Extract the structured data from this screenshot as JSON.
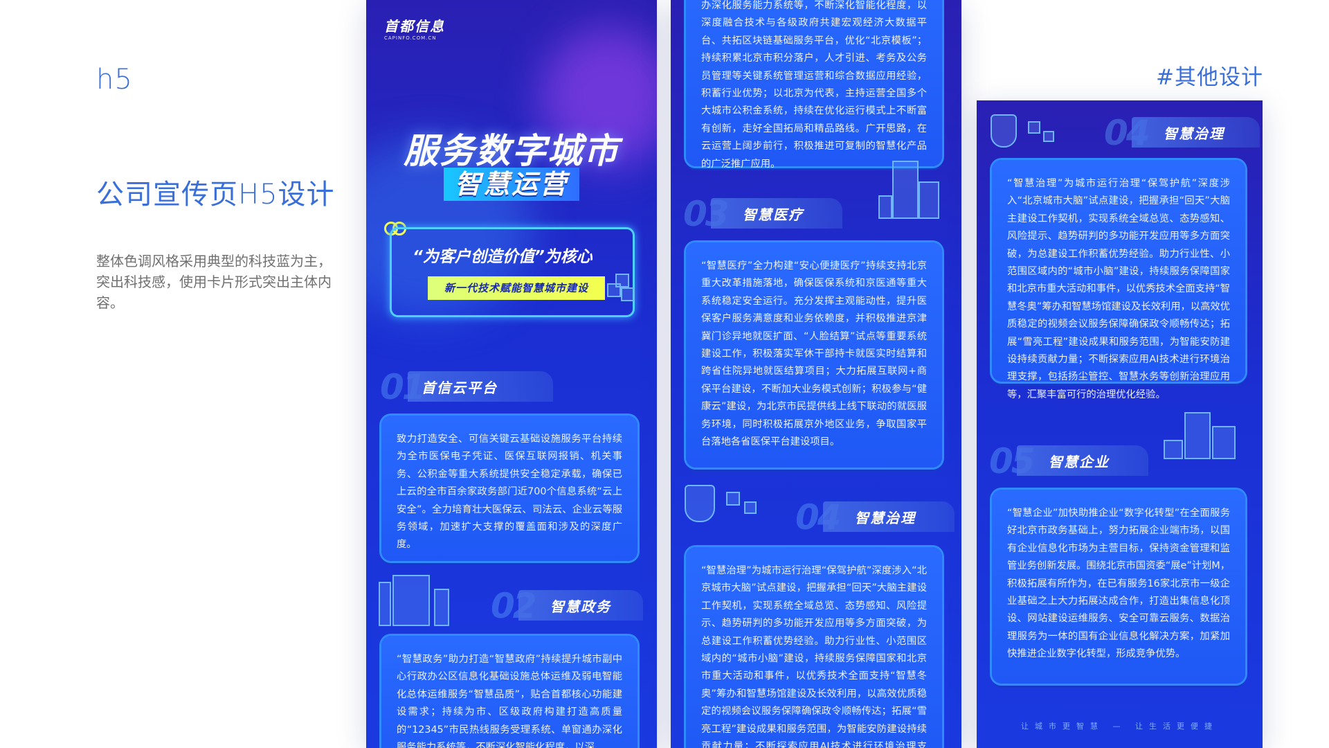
{
  "intro": {
    "h5": "h5",
    "title": "公司宣传页H5设计",
    "desc": "整体色调风格采用典型的科技蓝为主，突出科技感，使用卡片形式突出主体内容。",
    "other": "#其他设计"
  },
  "phone1": {
    "logo_cn": "首都信息",
    "logo_en": "CAPINFO.COM.CN",
    "hero_title": "服务数字城市",
    "hero_sub": "智慧运营",
    "hero_quote": "“为客户创造价值”为核心",
    "hero_banner": "新一代技术赋能智慧城市建设",
    "sec1": {
      "num": "01",
      "label": "首信云平台"
    },
    "card1": "致力打造安全、可信关键云基础设施服务平台持续为全市医保电子凭证、医保互联网报销、机关事务、公积金等重大系统提供安全稳定承载，确保已上云的全市百余家政务部门近700个信息系统“云上安全”。全力培育壮大医保云、司法云、企业云等服务领域，加速扩大支撑的覆盖面和涉及的深度广度。",
    "sec2": {
      "num": "02",
      "label": "智慧政务"
    },
    "card2": "“智慧政务”助力打造“智慧政府”持续提升城市副中心行政办公区信息化基础设施总体运维及弱电智能化总体运维服务“智慧品质”，贴合首都核心功能建设需求；持续为市、区级政府构建打造高质量的“12345”市民热线服务受理系统、单窗通办深化服务能力系统等，不断深化智能化程度，以深"
  },
  "phone2": {
    "card_top": "办深化服务能力系统等，不断深化智能化程度，以深度融合技术与各级政府共建宏观经济大数据平台、共拓区块链基础服务平台，优化“北京模板”；持续积累北京市积分落户，人才引进、考务及公务员管理等关键系统管理运营和综合数据应用经验，积蓄行业优势；以北京为代表，主持运营全国多个大城市公积金系统，持续在优化运行模式上不断富有创新，走好全国拓局和精品路线。广开思路，在云运营上阔步前行，积极推进可复制的智慧化产品的广泛推广应用。",
    "sec3": {
      "num": "03",
      "label": "智慧医疗"
    },
    "card3": "“智慧医疗”全力构建“安心便捷医疗”持续支持北京重大改革措施落地，确保医保系统和京医通等重大系统稳定安全运行。充分发挥主观能动性，提升医保客户服务满意度和业务依赖度，并积极推进京津冀门诊异地就医扩面、“人脸结算”试点等重要系统建设工作，积极落实军休干部持卡就医实时结算和跨省住院异地就医结算项目；大力拓展互联网+商保平台建设，不断加大业务模式创新；积极参与“健康云”建设，为北京市民提供线上线下联动的就医服务环境，同时积极拓展京外地区业务，争取国家平台落地各省医保平台建设项目。",
    "sec4": {
      "num": "04",
      "label": "智慧治理"
    },
    "card4": "“智慧治理”为城市运行治理“保驾护航”深度涉入“北京城市大脑”试点建设，把握承担“回天”大脑主建设工作契机，实现系统全域总览、态势感知、风险提示、趋势研判的多功能开发应用等多方面突破，为总建设工作积蓄优势经验。助力行业性、小范围区域内的“城市小脑”建设，持续服务保障国家和北京市重大活动和事件，以优秀技术全面支持“智慧冬奥”筹办和智慧场馆建设及长效利用，以高效优质稳定的视频会议服务保障确保政令顺畅传达；拓展“雪亮工程”建设成果和服务范围，为智能安防建设持续贡献力量；不断探索应用AI技术进行环境治理支撑，"
  },
  "phone3": {
    "sec4": {
      "num": "04",
      "label": "智慧治理"
    },
    "card4": "“智慧治理”为城市运行治理“保驾护航”深度涉入“北京城市大脑”试点建设，把握承担“回天”大脑主建设工作契机，实现系统全域总览、态势感知、风险提示、趋势研判的多功能开发应用等多方面突破，为总建设工作积蓄优势经验。助力行业性、小范围区域内的“城市小脑”建设，持续服务保障国家和北京市重大活动和事件，以优秀技术全面支持“智慧冬奥”筹办和智慧场馆建设及长效利用，以高效优质稳定的视频会议服务保障确保政令顺畅传达；拓展“雪亮工程”建设成果和服务范围，为智能安防建设持续贡献力量；不断探索应用AI技术进行环境治理支撑，包括扬尘管控、智慧水务等创新治理应用等，汇聚丰富可行的治理优化经验。",
    "sec5": {
      "num": "05",
      "label": "智慧企业"
    },
    "card5": "“智慧企业”加快助推企业“数字化转型”在全面服务好北京市政务基础上，努力拓展企业端市场，以国有企业信息化市场为主营目标，保持资金管理和监管业务创新发展。围绕北京市国资委“展e”计划M，积极拓展有所作为，在已有服务16家北京市一级企业基础之上大力拓展达成合作，打造出集信息化顶设、网站建设运维服务、安全可靠云服务、数据治理服务为一体的国有企业信息化解决方案，加紧加快推进企业数字化转型，形成竞争优势。",
    "footer": "让城市更智慧 — 让生活更便捷"
  },
  "colors": {
    "accent": "#3a6fd8",
    "bg_blue": "#1b2fd3",
    "card_blue": "#2a6bff",
    "banner_yellow": "#f3ff4e"
  }
}
